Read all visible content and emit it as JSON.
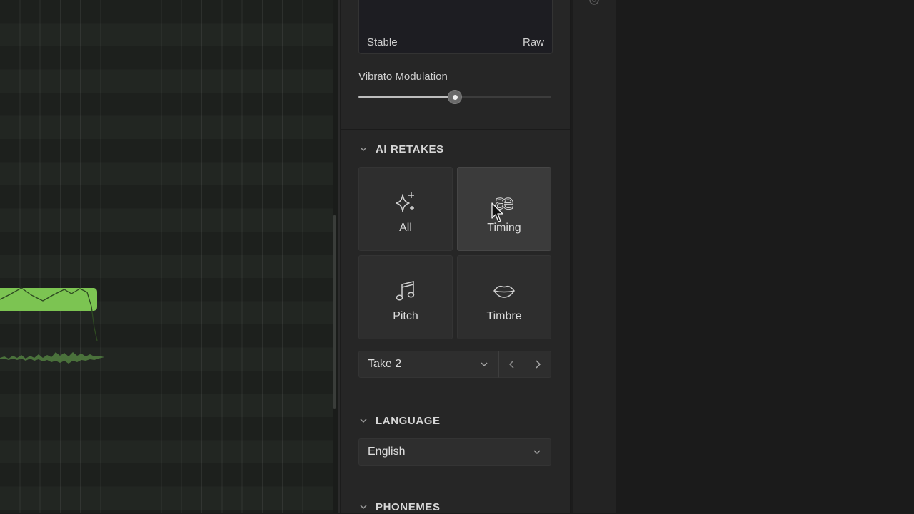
{
  "mixer": {
    "left_label": "Stable",
    "right_label": "Raw"
  },
  "vibrato": {
    "label": "Vibrato Modulation",
    "value_fraction": 0.5
  },
  "ai_retakes": {
    "title": "AI RETAKES",
    "tiles": [
      {
        "label": "All",
        "icon": "sparkles-icon"
      },
      {
        "label": "Timing",
        "icon": "ae-ligature-icon",
        "active": true
      },
      {
        "label": "Pitch",
        "icon": "music-note-icon"
      },
      {
        "label": "Timbre",
        "icon": "lips-icon"
      }
    ],
    "take_select": "Take 2"
  },
  "language": {
    "title": "LANGUAGE",
    "selected": "English"
  },
  "phonemes": {
    "title": "PHONEMES"
  },
  "colors": {
    "note_green": "#7cc452",
    "panel": "#262626",
    "tile_active": "#3b3b3b"
  }
}
